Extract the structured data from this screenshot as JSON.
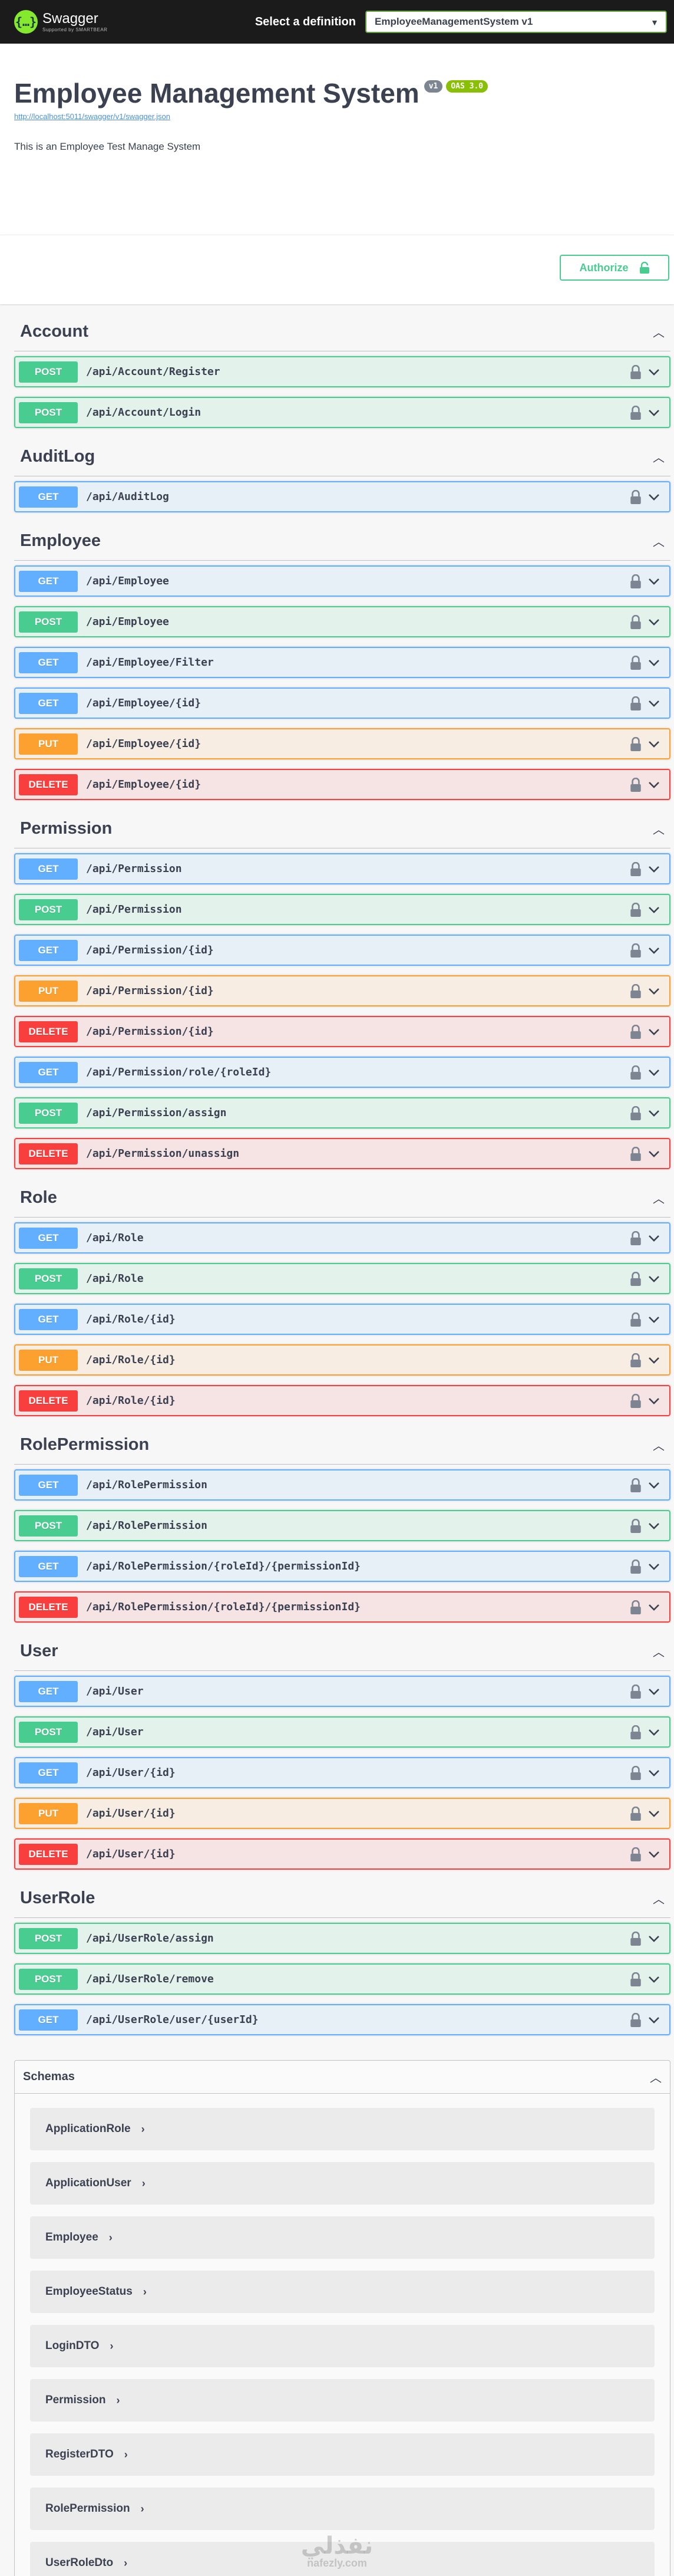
{
  "topbar": {
    "logo_name": "Swagger",
    "logo_sub": "Supported by SMARTBEAR",
    "definition_label": "Select a definition",
    "definition_value": "EmployeeManagementSystem v1"
  },
  "info": {
    "title": "Employee Management System",
    "version_badge": "v1",
    "oas_badge": "OAS 3.0",
    "spec_url": "http://localhost:5011/swagger/v1/swagger.json",
    "description": "This is an Employee Test Manage System"
  },
  "authorize_label": "Authorize",
  "tags": [
    {
      "name": "Account",
      "ops": [
        {
          "method": "POST",
          "path": "/api/Account/Register"
        },
        {
          "method": "POST",
          "path": "/api/Account/Login"
        }
      ]
    },
    {
      "name": "AuditLog",
      "ops": [
        {
          "method": "GET",
          "path": "/api/AuditLog"
        }
      ]
    },
    {
      "name": "Employee",
      "ops": [
        {
          "method": "GET",
          "path": "/api/Employee"
        },
        {
          "method": "POST",
          "path": "/api/Employee"
        },
        {
          "method": "GET",
          "path": "/api/Employee/Filter"
        },
        {
          "method": "GET",
          "path": "/api/Employee/{id}"
        },
        {
          "method": "PUT",
          "path": "/api/Employee/{id}"
        },
        {
          "method": "DELETE",
          "path": "/api/Employee/{id}"
        }
      ]
    },
    {
      "name": "Permission",
      "ops": [
        {
          "method": "GET",
          "path": "/api/Permission"
        },
        {
          "method": "POST",
          "path": "/api/Permission"
        },
        {
          "method": "GET",
          "path": "/api/Permission/{id}"
        },
        {
          "method": "PUT",
          "path": "/api/Permission/{id}"
        },
        {
          "method": "DELETE",
          "path": "/api/Permission/{id}"
        },
        {
          "method": "GET",
          "path": "/api/Permission/role/{roleId}"
        },
        {
          "method": "POST",
          "path": "/api/Permission/assign"
        },
        {
          "method": "DELETE",
          "path": "/api/Permission/unassign"
        }
      ]
    },
    {
      "name": "Role",
      "ops": [
        {
          "method": "GET",
          "path": "/api/Role"
        },
        {
          "method": "POST",
          "path": "/api/Role"
        },
        {
          "method": "GET",
          "path": "/api/Role/{id}"
        },
        {
          "method": "PUT",
          "path": "/api/Role/{id}"
        },
        {
          "method": "DELETE",
          "path": "/api/Role/{id}"
        }
      ]
    },
    {
      "name": "RolePermission",
      "ops": [
        {
          "method": "GET",
          "path": "/api/RolePermission"
        },
        {
          "method": "POST",
          "path": "/api/RolePermission"
        },
        {
          "method": "GET",
          "path": "/api/RolePermission/{roleId}/{permissionId}"
        },
        {
          "method": "DELETE",
          "path": "/api/RolePermission/{roleId}/{permissionId}"
        }
      ]
    },
    {
      "name": "User",
      "ops": [
        {
          "method": "GET",
          "path": "/api/User"
        },
        {
          "method": "POST",
          "path": "/api/User"
        },
        {
          "method": "GET",
          "path": "/api/User/{id}"
        },
        {
          "method": "PUT",
          "path": "/api/User/{id}"
        },
        {
          "method": "DELETE",
          "path": "/api/User/{id}"
        }
      ]
    },
    {
      "name": "UserRole",
      "ops": [
        {
          "method": "POST",
          "path": "/api/UserRole/assign"
        },
        {
          "method": "POST",
          "path": "/api/UserRole/remove"
        },
        {
          "method": "GET",
          "path": "/api/UserRole/user/{userId}"
        }
      ]
    }
  ],
  "schemas": {
    "title": "Schemas",
    "items": [
      "ApplicationRole",
      "ApplicationUser",
      "Employee",
      "EmployeeStatus",
      "LoginDTO",
      "Permission",
      "RegisterDTO",
      "RolePermission",
      "UserRoleDto"
    ]
  },
  "watermark": {
    "main": "نفذلي",
    "sub": "nafezly.com"
  },
  "colors": {
    "get": "#61affe",
    "post": "#49cc90",
    "put": "#fca130",
    "delete": "#f93e3e",
    "topbar": "#1b1b1b",
    "logo": "#85ea2d"
  }
}
